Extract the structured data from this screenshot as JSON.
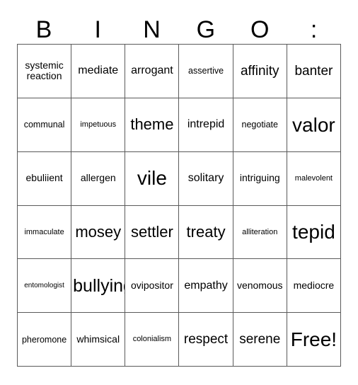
{
  "card": {
    "header": {
      "letters": [
        "B",
        "I",
        "N",
        "G",
        "O",
        ":"
      ]
    },
    "columns": 6,
    "rows": 6,
    "colors": {
      "background": "#ffffff",
      "border": "#5a5a5a",
      "text": "#000000"
    },
    "cells": [
      [
        {
          "text": "systemic reaction",
          "size": "fs-m"
        },
        {
          "text": "mediate",
          "size": "fs-l"
        },
        {
          "text": "arrogant",
          "size": "fs-l"
        },
        {
          "text": "assertive",
          "size": "fs-s"
        },
        {
          "text": "affinity",
          "size": "fs-xl"
        },
        {
          "text": "banter",
          "size": "fs-xl"
        }
      ],
      [
        {
          "text": "communal",
          "size": "fs-s"
        },
        {
          "text": "impetuous",
          "size": "fs-xs"
        },
        {
          "text": "theme",
          "size": "fs-xxl"
        },
        {
          "text": "intrepid",
          "size": "fs-l"
        },
        {
          "text": "negotiate",
          "size": "fs-s"
        },
        {
          "text": "valor",
          "size": "fs-4xl"
        }
      ],
      [
        {
          "text": "ebuliient",
          "size": "fs-m"
        },
        {
          "text": "allergen",
          "size": "fs-m"
        },
        {
          "text": "vile",
          "size": "fs-4xl"
        },
        {
          "text": "solitary",
          "size": "fs-l"
        },
        {
          "text": "intriguing",
          "size": "fs-m"
        },
        {
          "text": "malevolent",
          "size": "fs-xs"
        }
      ],
      [
        {
          "text": "immaculate",
          "size": "fs-xs"
        },
        {
          "text": "mosey",
          "size": "fs-xxl"
        },
        {
          "text": "settler",
          "size": "fs-xxl"
        },
        {
          "text": "treaty",
          "size": "fs-xxl"
        },
        {
          "text": "alliteration",
          "size": "fs-xs"
        },
        {
          "text": "tepid",
          "size": "fs-4xl"
        }
      ],
      [
        {
          "text": "entomologist",
          "size": "fs-xxs"
        },
        {
          "text": "bullying",
          "size": "fs-3xl"
        },
        {
          "text": "ovipositor",
          "size": "fs-m"
        },
        {
          "text": "empathy",
          "size": "fs-l"
        },
        {
          "text": "venomous",
          "size": "fs-m"
        },
        {
          "text": "mediocre",
          "size": "fs-m"
        }
      ],
      [
        {
          "text": "pheromone",
          "size": "fs-s"
        },
        {
          "text": "whimsical",
          "size": "fs-m"
        },
        {
          "text": "colonialism",
          "size": "fs-xs"
        },
        {
          "text": "respect",
          "size": "fs-xl"
        },
        {
          "text": "serene",
          "size": "fs-xl"
        },
        {
          "text": "Free!",
          "size": "fs-4xl"
        }
      ]
    ]
  }
}
